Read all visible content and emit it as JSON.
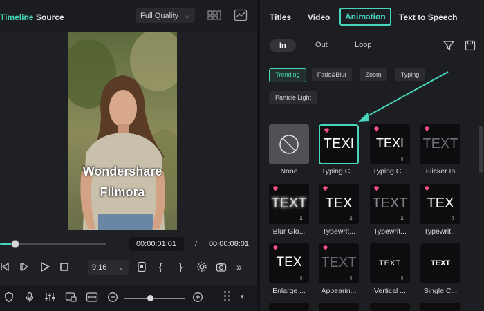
{
  "player": {
    "tabs": [
      "Timeline",
      "Source"
    ],
    "quality": "Full Quality",
    "overlay_title": "Wondershare Filmora",
    "overlay_line1": "Wondershare",
    "overlay_line2": "Filmora",
    "current_time": "00:00:01:01",
    "separator": "/",
    "total_time": "00:00:08:01",
    "progress": 0.06,
    "aspect_ratio": "9:16",
    "zoom_level": 0.4
  },
  "panel": {
    "tabs": [
      "Titles",
      "Video",
      "Animation",
      "Text to Speech"
    ],
    "active_tab": "Animation",
    "subtabs": [
      "In",
      "Out",
      "Loop"
    ],
    "active_subtab": "In",
    "categories": [
      "Trending",
      "Fade&Blur",
      "Zoom",
      "Typing",
      "Particle Light"
    ],
    "active_category": "Trending",
    "items": [
      {
        "label": "None",
        "preview": ""
      },
      {
        "label": "Typing C...",
        "preview": "TEXI"
      },
      {
        "label": "Typing C...",
        "preview": "TEXI"
      },
      {
        "label": "Flicker In",
        "preview": "TEXT"
      },
      {
        "label": "Blur Glo...",
        "preview": "TEXT"
      },
      {
        "label": "Typewrit...",
        "preview": "TEX"
      },
      {
        "label": "Typewrit...",
        "preview": "TEXT"
      },
      {
        "label": "Typewrit...",
        "preview": "TEX"
      },
      {
        "label": "Enlarge ...",
        "preview": "TEX"
      },
      {
        "label": "Appearin...",
        "preview": "TEXT"
      },
      {
        "label": "Vertical ...",
        "preview": "TEXT"
      },
      {
        "label": "Single C...",
        "preview": "TEXT"
      }
    ]
  },
  "colors": {
    "accent": "#46d6bb",
    "premium": "#ff4f8b"
  }
}
